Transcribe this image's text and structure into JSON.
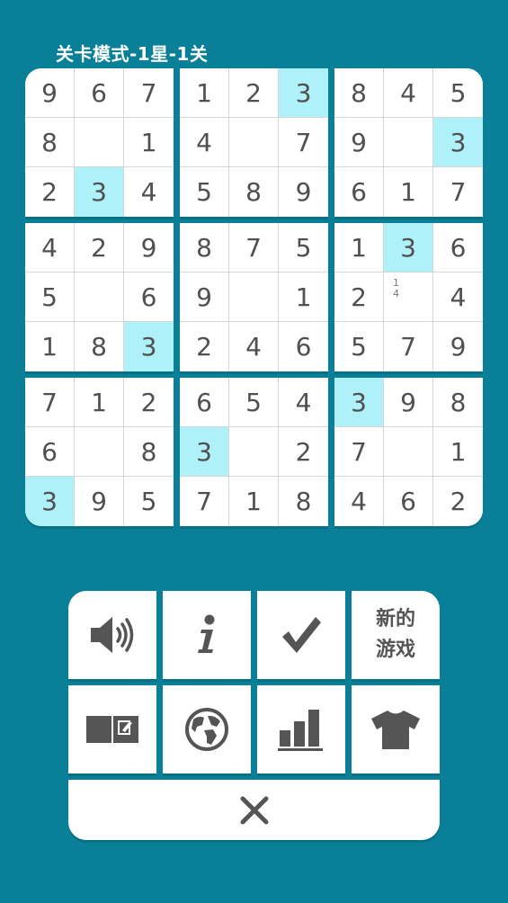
{
  "header": {
    "title": "关卡模式-1星-1关"
  },
  "board": {
    "rows": [
      [
        "9",
        "6",
        "7",
        "1",
        "2",
        "3",
        "8",
        "4",
        "5"
      ],
      [
        "8",
        "",
        "1",
        "4",
        "",
        "7",
        "9",
        "",
        "3"
      ],
      [
        "2",
        "3",
        "4",
        "5",
        "8",
        "9",
        "6",
        "1",
        "7"
      ],
      [
        "4",
        "2",
        "9",
        "8",
        "7",
        "5",
        "1",
        "3",
        "6"
      ],
      [
        "5",
        "",
        "6",
        "9",
        "",
        "1",
        "2",
        "",
        "4"
      ],
      [
        "1",
        "8",
        "3",
        "2",
        "4",
        "6",
        "5",
        "7",
        "9"
      ],
      [
        "7",
        "1",
        "2",
        "6",
        "5",
        "4",
        "3",
        "9",
        "8"
      ],
      [
        "6",
        "",
        "8",
        "3",
        "",
        "2",
        "7",
        "",
        "1"
      ],
      [
        "3",
        "9",
        "5",
        "7",
        "1",
        "8",
        "4",
        "6",
        "2"
      ]
    ],
    "highlighted": [
      [
        0,
        5
      ],
      [
        1,
        8
      ],
      [
        2,
        1
      ],
      [
        3,
        7
      ],
      [
        5,
        2
      ],
      [
        6,
        6
      ],
      [
        7,
        3
      ],
      [
        8,
        0
      ]
    ],
    "notes": {
      "4,7": [
        "1",
        "4"
      ]
    }
  },
  "panel": {
    "buttons": [
      {
        "name": "sound-button",
        "icon": "speaker-icon"
      },
      {
        "name": "info-button",
        "icon": "info-icon"
      },
      {
        "name": "check-button",
        "icon": "checkmark-icon"
      },
      {
        "name": "new-game-button",
        "label_line1": "新的",
        "label_line2": "游戏"
      },
      {
        "name": "notes-mode-button",
        "icon": "notebook-edit-icon"
      },
      {
        "name": "globe-button",
        "icon": "globe-icon"
      },
      {
        "name": "stats-button",
        "icon": "bar-chart-icon"
      },
      {
        "name": "theme-button",
        "icon": "tshirt-icon"
      }
    ],
    "close": {
      "icon": "close-icon"
    }
  },
  "colors": {
    "background": "#0a8098",
    "cell": "#ffffff",
    "highlight": "#aef1f8",
    "digit": "#505050",
    "icon": "#555555"
  }
}
